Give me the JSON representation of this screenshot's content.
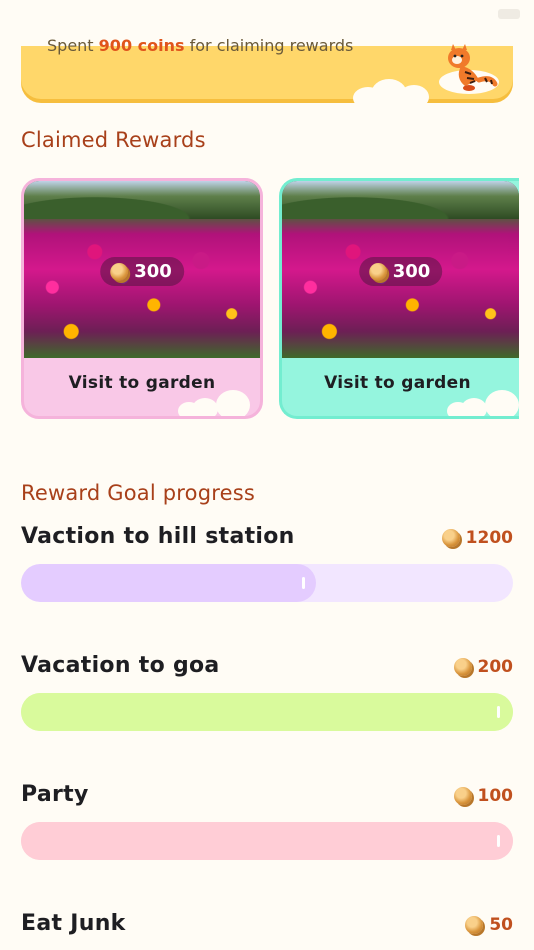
{
  "banner": {
    "prefix": "Spent",
    "coins": "900 coins",
    "suffix": "for claiming rewards"
  },
  "claimed": {
    "title": "Claimed Rewards",
    "cards": [
      {
        "label": "Visit to garden",
        "coins": "300",
        "bg": "#F9C8E7"
      },
      {
        "label": "Visit to garden",
        "coins": "300",
        "bg": "#95F5DE"
      }
    ]
  },
  "progress": {
    "title": "Reward Goal progress",
    "goals": [
      {
        "name": "Vaction to hill station",
        "coins": "1200",
        "fraction": 0.6,
        "track": "#F2E6FF",
        "fill": "#E4CCFF"
      },
      {
        "name": "Vacation to goa",
        "coins": "200",
        "fraction": 1.0,
        "track": "#D9FA9C",
        "fill": "#D9FA9C"
      },
      {
        "name": "Party",
        "coins": "100",
        "fraction": 1.0,
        "track": "#FFCDD6",
        "fill": "#FFCDD6"
      },
      {
        "name": "Eat Junk",
        "coins": "50"
      }
    ]
  },
  "icons": {
    "coin": "coin-icon",
    "mascot": "tiger-mascot"
  }
}
